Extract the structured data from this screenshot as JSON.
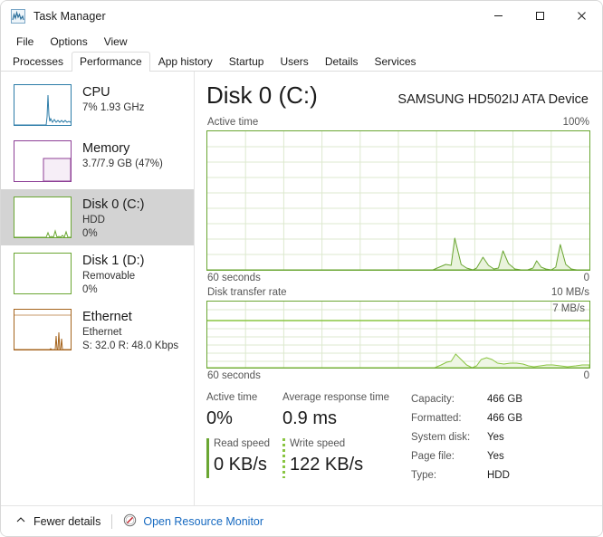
{
  "window": {
    "title": "Task Manager",
    "icon": "task-manager-icon",
    "minimize_label": "Minimize",
    "maximize_label": "Maximize",
    "close_label": "Close"
  },
  "menu": {
    "items": [
      {
        "label": "File"
      },
      {
        "label": "Options"
      },
      {
        "label": "View"
      }
    ]
  },
  "tabs": [
    {
      "label": "Processes",
      "active": false
    },
    {
      "label": "Performance",
      "active": true
    },
    {
      "label": "App history",
      "active": false
    },
    {
      "label": "Startup",
      "active": false
    },
    {
      "label": "Users",
      "active": false
    },
    {
      "label": "Details",
      "active": false
    },
    {
      "label": "Services",
      "active": false
    }
  ],
  "sidebar": {
    "items": [
      {
        "name": "CPU",
        "line1": "7%  1.93 GHz",
        "line2": "",
        "color": "#2c7ca8",
        "selected": false
      },
      {
        "name": "Memory",
        "line1": "3.7/7.9 GB (47%)",
        "line2": "",
        "color": "#8d3f96",
        "selected": false
      },
      {
        "name": "Disk 0 (C:)",
        "line1": "HDD",
        "line2": "0%",
        "color": "#6aa632",
        "selected": true
      },
      {
        "name": "Disk 1 (D:)",
        "line1": "Removable",
        "line2": "0%",
        "color": "#6aa632",
        "selected": false
      },
      {
        "name": "Ethernet",
        "line1": "Ethernet",
        "line2": "S: 32.0 R: 48.0 Kbps",
        "color": "#a5641d",
        "selected": false
      }
    ]
  },
  "main": {
    "title": "Disk 0 (C:)",
    "device": "SAMSUNG HD502IJ ATA Device",
    "accent": "#6aa632",
    "active_graph": {
      "label": "Active time",
      "max_label": "100%",
      "left_foot": "60 seconds",
      "right_foot": "0"
    },
    "transfer_graph": {
      "label": "Disk transfer rate",
      "max_label": "10 MB/s",
      "scale_label": "7 MB/s",
      "left_foot": "60 seconds",
      "right_foot": "0"
    },
    "stats": {
      "active_time_label": "Active time",
      "active_time_value": "0%",
      "response_label": "Average response time",
      "response_value": "0.9 ms",
      "read_label": "Read speed",
      "read_value": "0 KB/s",
      "write_label": "Write speed",
      "write_value": "122 KB/s"
    },
    "info": [
      {
        "key": "Capacity:",
        "value": "466 GB"
      },
      {
        "key": "Formatted:",
        "value": "466 GB"
      },
      {
        "key": "System disk:",
        "value": "Yes"
      },
      {
        "key": "Page file:",
        "value": "Yes"
      },
      {
        "key": "Type:",
        "value": "HDD"
      }
    ]
  },
  "statusbar": {
    "fewer_details": "Fewer details",
    "resource_monitor": "Open Resource Monitor"
  },
  "chart_data": [
    {
      "type": "area",
      "title": "Active time",
      "ylabel": "Active time",
      "xlabel": "60 seconds",
      "ylim": [
        0,
        100
      ],
      "ymax_label": "100%",
      "ymin_label": "0",
      "grid": true,
      "grid_cols": 10,
      "grid_rows": 6,
      "color": "#6aa632",
      "x": [
        0,
        2,
        4,
        6,
        8,
        10,
        12,
        14,
        16,
        18,
        20,
        22,
        24,
        26,
        28,
        30,
        32,
        34,
        36,
        38,
        40,
        42,
        44,
        46,
        48,
        50,
        52,
        54,
        56,
        58,
        60
      ],
      "values": [
        0,
        0,
        0,
        0,
        0,
        0,
        0,
        0,
        0,
        0,
        0,
        0,
        0,
        0,
        0,
        0,
        0,
        0,
        0,
        0,
        0,
        1,
        11,
        2,
        0,
        1,
        4,
        1,
        6,
        1,
        0,
        0,
        1,
        0,
        5,
        0
      ]
    },
    {
      "type": "area",
      "title": "Disk transfer rate",
      "ylabel": "Disk transfer rate",
      "xlabel": "60 seconds",
      "ylim": [
        0,
        10
      ],
      "ymax_label": "10 MB/s",
      "ymin_label": "0",
      "scale_line_value": 7,
      "scale_line_label": "7 MB/s",
      "grid": true,
      "grid_cols": 10,
      "grid_rows": 8,
      "color": "#6aa632",
      "x": [
        0,
        2,
        4,
        6,
        8,
        10,
        12,
        14,
        16,
        18,
        20,
        22,
        24,
        26,
        28,
        30,
        32,
        34,
        36,
        38,
        40,
        42,
        44,
        46,
        48,
        50,
        52,
        54,
        56,
        58,
        60
      ],
      "values": [
        0,
        0,
        0,
        0,
        0,
        0,
        0,
        0,
        0,
        0,
        0,
        0,
        0,
        0,
        0,
        0,
        0,
        0,
        0,
        0,
        0.1,
        0.9,
        1.6,
        0.9,
        0.1,
        0.8,
        0.8,
        0.5,
        0.5,
        0.3,
        0.1,
        0.4,
        0.3,
        0.2,
        0.1
      ]
    }
  ]
}
